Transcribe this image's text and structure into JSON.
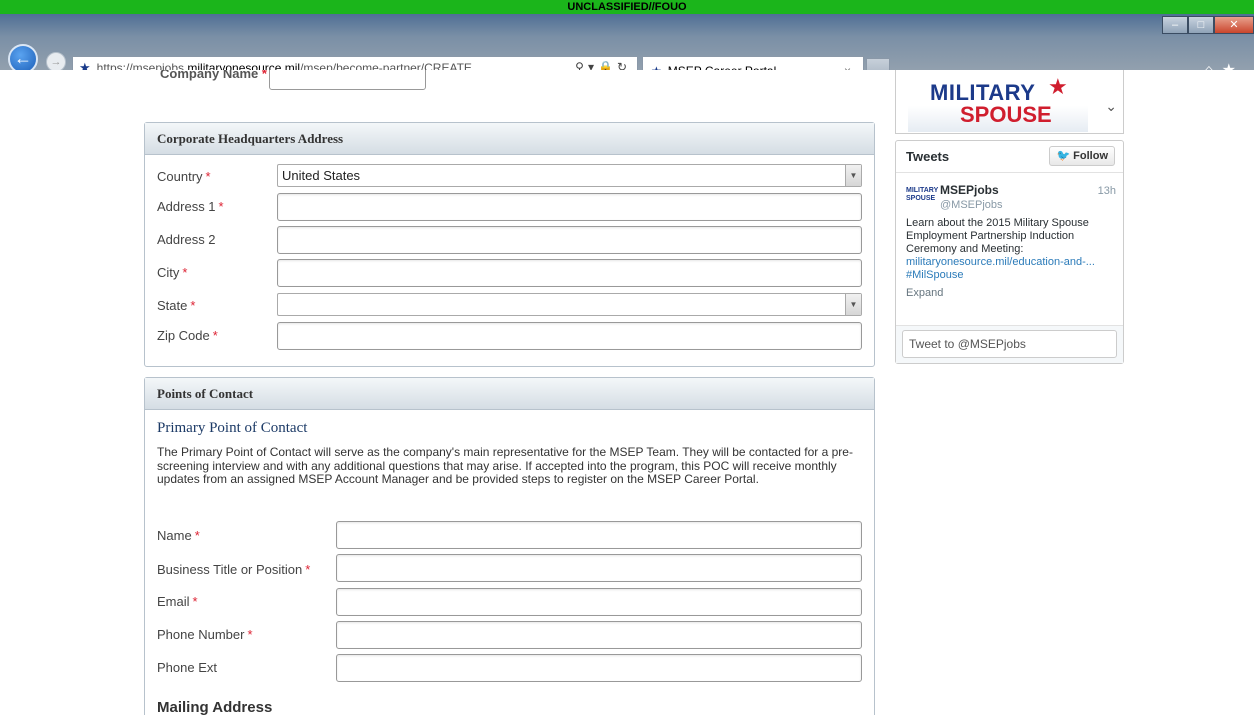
{
  "classification_banner": "UNCLASSIFIED//FOUO",
  "browser": {
    "url_prefix": "https://msepjobs.",
    "url_domain": "militaryonesource.mil",
    "url_path": "/msep/become-partner/CREATE",
    "tab_title": "MSEP Career Portal",
    "tab_close": "×"
  },
  "company": {
    "label": "Company Name",
    "required_mark": "*"
  },
  "hq_panel": {
    "title": "Corporate Headquarters Address",
    "fields": [
      {
        "label": "Country",
        "required": "*",
        "value": "United States"
      },
      {
        "label": "Address 1",
        "required": "*"
      },
      {
        "label": "Address 2",
        "required": ""
      },
      {
        "label": "City",
        "required": "*"
      },
      {
        "label": "State",
        "required": "*",
        "value": ""
      },
      {
        "label": "Zip Code",
        "required": "*"
      }
    ]
  },
  "poc_panel": {
    "title": "Points of Contact",
    "subtitle": "Primary Point of Contact",
    "description": "The Primary Point of Contact will serve as the company's main representative for the MSEP Team. They will be contacted for a pre-screening interview and with any additional questions that may arise.  If accepted into the program, this POC will receive monthly updates from an assigned MSEP Account Manager and be provided steps to register on the MSEP Career Portal.",
    "fields": [
      {
        "label": "Name",
        "required": "*"
      },
      {
        "label": "Business Title or Position",
        "required": "*"
      },
      {
        "label": "Email",
        "required": "*"
      },
      {
        "label": "Phone Number",
        "required": "*"
      },
      {
        "label": "Phone Ext",
        "required": ""
      }
    ],
    "mailing_title": "Mailing Address"
  },
  "sidebar": {
    "logo_line1": "MILITARY",
    "logo_line2": "SPOUSE"
  },
  "tweets": {
    "title": "Tweets",
    "follow_label": "Follow",
    "tweet": {
      "name": "MSEPjobs",
      "handle": "@MSEPjobs",
      "time": "13h",
      "text": "Learn about the 2015 Military Spouse Employment Partnership Induction Ceremony and Meeting:",
      "link": "militaryonesource.mil/education-and-... #MilSpouse",
      "expand": "Expand"
    },
    "compose_placeholder": "Tweet to @MSEPjobs"
  }
}
